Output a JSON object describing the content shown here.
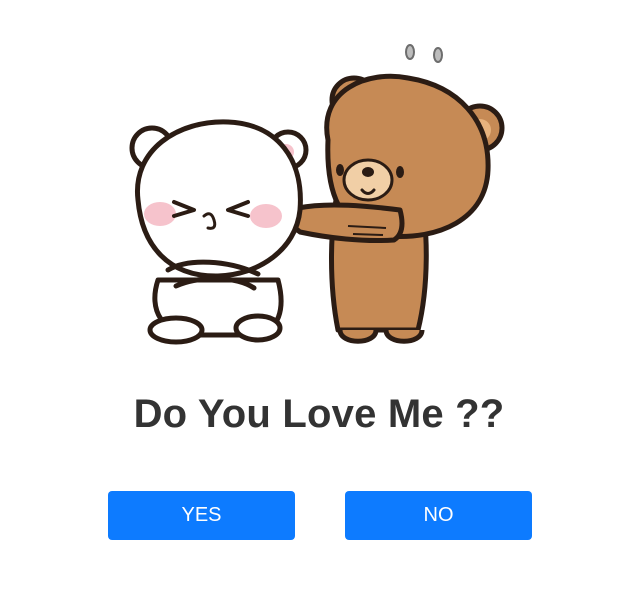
{
  "question": {
    "text": "Do You Love Me ??"
  },
  "buttons": {
    "yes_label": "YES",
    "no_label": "NO"
  },
  "illustration": {
    "icon": "bears-illustration",
    "colors": {
      "white_bear": "#ffffff",
      "brown_bear": "#c68a55",
      "outline": "#2b1c14",
      "blush": "#f6c3cc"
    }
  },
  "colors": {
    "button_bg": "#0d7bff",
    "button_text": "#ffffff",
    "question_text": "#333333"
  }
}
